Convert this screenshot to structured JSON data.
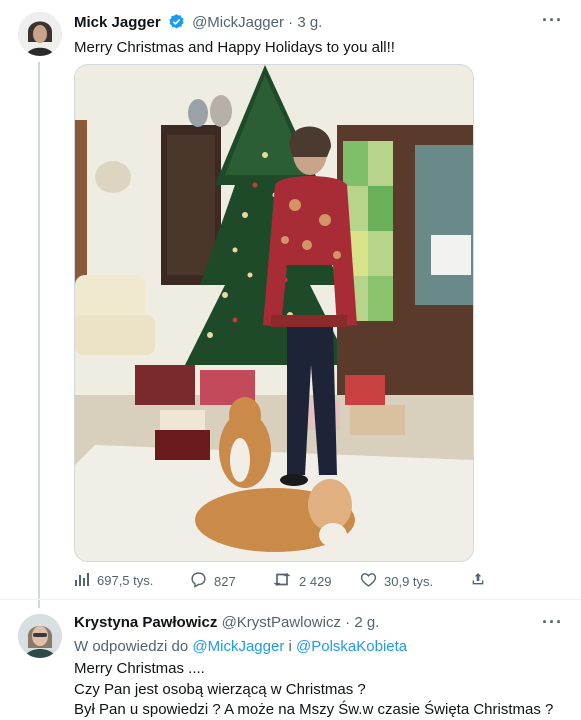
{
  "tweet": {
    "author_name": "Mick Jagger",
    "author_handle": "@MickJagger",
    "time_sep": " · ",
    "time": "3 g.",
    "text": "Merry Christmas and Happy Holidays to you all!!",
    "stats": {
      "views": "697,5 tys.",
      "replies": "827",
      "retweets": "2 429",
      "likes": "30,9 tys."
    }
  },
  "reply": {
    "author_name": "Krystyna Pawłowicz",
    "author_handle": "@KrystPawlowicz",
    "time_sep": " · ",
    "time": "2 g.",
    "reply_prefix": "W odpowiedzi do",
    "mention1": "@MickJagger",
    "conj": "i",
    "mention2": "@PolskaKobieta",
    "lines": [
      "Merry Christmas ....",
      "Czy Pan jest osobą wierzącą w Christmas ?",
      "Był Pan u spowiedzi ? A może na Mszy Św.w czasie Święta Christmas ?"
    ]
  },
  "colors": {
    "accent": "#1d9bf0",
    "secondary_text": "#536471",
    "primary_text": "#0f1419",
    "divider": "#eff3f4"
  },
  "icons": [
    "views-icon",
    "reply-icon",
    "retweet-icon",
    "like-icon",
    "share-icon",
    "verified-badge-icon",
    "more-icon"
  ]
}
